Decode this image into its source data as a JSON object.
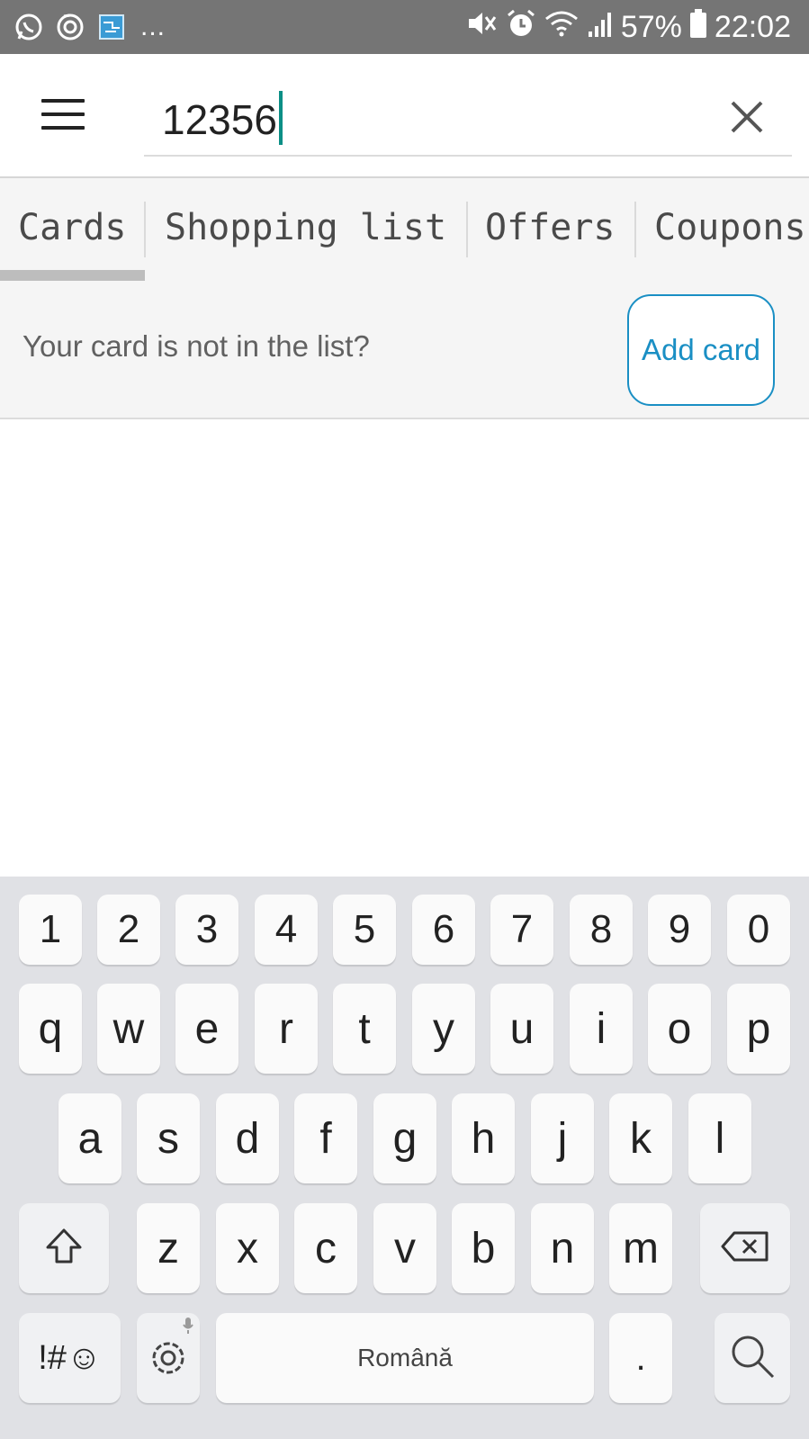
{
  "status_bar": {
    "left_icons": [
      "whatsapp-icon",
      "sync-icon",
      "app-icon"
    ],
    "overflow": "...",
    "battery_percent": "57%",
    "time": "22:02",
    "right_icons": [
      "mute-icon",
      "alarm-icon",
      "wifi-icon",
      "signal-icon",
      "battery-icon"
    ]
  },
  "search": {
    "value": "12356",
    "menu_icon": "menu-icon",
    "clear_icon": "close-icon"
  },
  "tabs": [
    {
      "label": "Cards",
      "selected": true
    },
    {
      "label": "Shopping list",
      "selected": false
    },
    {
      "label": "Offers",
      "selected": false
    },
    {
      "label": "Coupons",
      "selected": false
    }
  ],
  "add_card_row": {
    "prompt": "Your card is not in the list?",
    "button_label": "Add card"
  },
  "keyboard": {
    "number_row": [
      "1",
      "2",
      "3",
      "4",
      "5",
      "6",
      "7",
      "8",
      "9",
      "0"
    ],
    "row1": [
      "q",
      "w",
      "e",
      "r",
      "t",
      "y",
      "u",
      "i",
      "o",
      "p"
    ],
    "row2": [
      "a",
      "s",
      "d",
      "f",
      "g",
      "h",
      "j",
      "k",
      "l"
    ],
    "row3": [
      "z",
      "x",
      "c",
      "v",
      "b",
      "n",
      "m"
    ],
    "symbols_label": "!#☺",
    "space_label": "Română",
    "period": ".",
    "shift_icon": "shift-icon",
    "backspace_icon": "backspace-icon",
    "settings_icon": "settings-icon",
    "search_icon": "search-icon"
  },
  "colors": {
    "status_bar": "#757575",
    "accent": "#1a8fc4",
    "caret": "#0b8f86",
    "tab_indicator": "#bdbdbd"
  }
}
